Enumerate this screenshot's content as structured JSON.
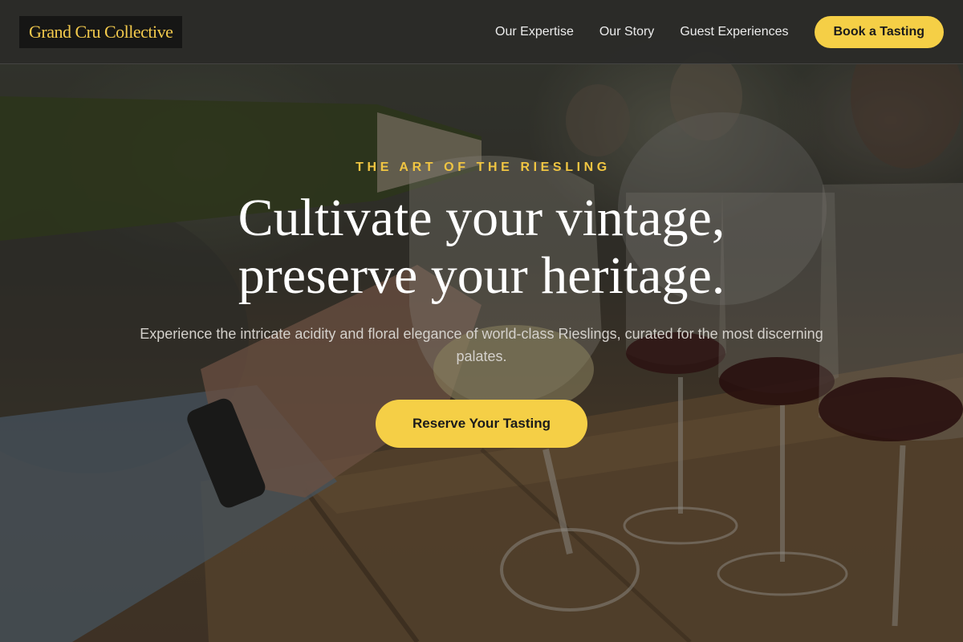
{
  "header": {
    "logo": "Grand Cru Collective",
    "nav": [
      "Our Expertise",
      "Our Story",
      "Guest Experiences"
    ],
    "cta": "Book a Tasting"
  },
  "hero": {
    "eyebrow": "THE ART OF THE RIESLING",
    "headline_line1": "Cultivate your vintage,",
    "headline_line2": "preserve your heritage.",
    "subtitle": "Experience the intricate acidity and floral elegance of world-class Rieslings, curated for the most discerning palates.",
    "cta": "Reserve Your Tasting",
    "background_image": "wine-pouring-photo"
  },
  "colors": {
    "accent": "#f5cf46",
    "eyebrow": "#f0c542",
    "header_bg": "#2a2a28",
    "logo_bg": "#161615"
  }
}
